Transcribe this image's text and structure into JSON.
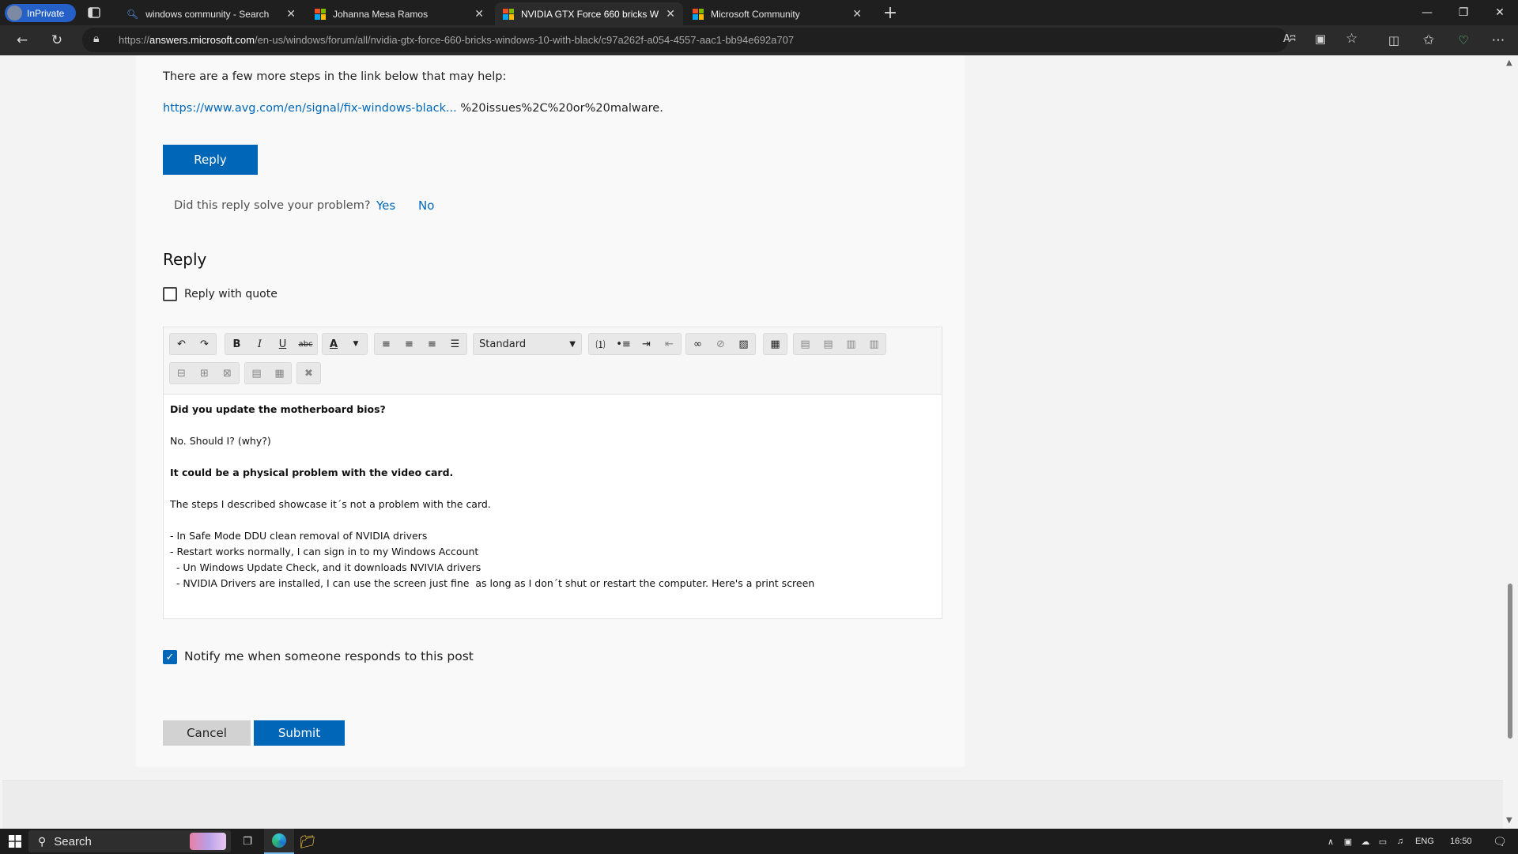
{
  "browser": {
    "inprivate_label": "InPrivate",
    "tabs": [
      {
        "title": "windows community - Search",
        "active": false
      },
      {
        "title": "Johanna Mesa Ramos",
        "active": false
      },
      {
        "title": "NVIDIA GTX Force 660 bricks Wi",
        "active": true
      },
      {
        "title": "Microsoft Community",
        "active": false
      }
    ],
    "new_tab": "+",
    "url_prefix": "https://",
    "url_domain": "answers.microsoft.com",
    "url_path": "/en-us/windows/forum/all/nvidia-gtx-force-660-bricks-windows-10-with-black/c97a262f-a054-4557-aac1-bb94e692a707",
    "read_aloud": "Aʭ"
  },
  "post": {
    "intro_text": "There are a few more steps in the link below that may help:",
    "link_text": "https://www.avg.com/en/signal/fix-windows-black...",
    "link_suffix": " %20issues%2C%20or%20malware.",
    "reply_button": "Reply",
    "solve_question": "Did this reply solve your problem?",
    "yes_label": "Yes",
    "no_label": "No"
  },
  "reply_form": {
    "heading": "Reply",
    "quote_label": "Reply with quote",
    "style_select": "Standard",
    "editor_lines": [
      {
        "text": "Did you update the motherboard bios?",
        "bold": true
      },
      {
        "text": "No. Should I? (why?)",
        "bold": false
      },
      {
        "text": "It could be a physical problem with the video card.",
        "bold": true
      },
      {
        "text": "The steps I described showcase it´s not a problem with the card.",
        "bold": false
      },
      {
        "text": "- In Safe Mode DDU clean removal of NVIDIA drivers",
        "bold": false
      },
      {
        "text": "- Restart works normally, I can sign in to my Windows Account",
        "bold": false
      },
      {
        "text": "  - Un Windows Update Check, and it downloads NVIVIA drivers",
        "bold": false
      },
      {
        "text": "  - NVIDIA Drivers are installed, I can use the screen just fine  as long as I don´t shut or restart the computer. Here's a print screen",
        "bold": false
      }
    ],
    "notify_label": "Notify me when someone responds to this post",
    "cancel_button": "Cancel",
    "submit_button": "Submit"
  },
  "taskbar": {
    "search_label": "Search",
    "language": "ENG",
    "time": "16:50"
  },
  "colors": {
    "accent": "#0067b8",
    "tab_bar": "#1f1f1f",
    "toolbar": "#2b2b2b",
    "inprivate": "#2560c9"
  }
}
